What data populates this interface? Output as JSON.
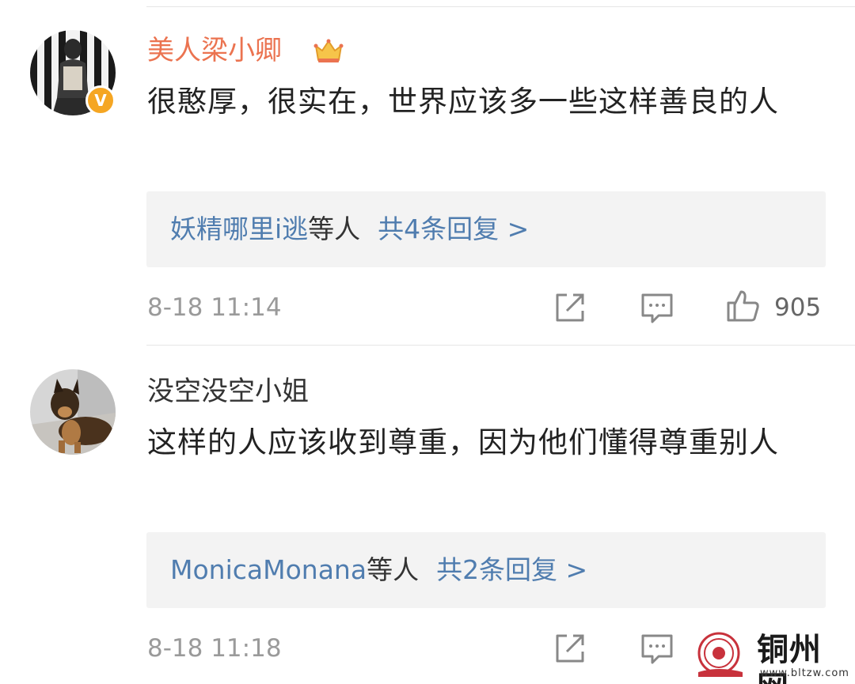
{
  "comments": [
    {
      "username": "美人梁小卿",
      "text": "很憨厚，很实在，世界应该多一些这样善良的人",
      "replies": {
        "names": "妖精哪里i逃",
        "suffix": "等人",
        "count": "共4条回复 >"
      },
      "time": "8-18 11:14",
      "likes": "905",
      "verified": "V",
      "badge_icon": "crown-icon"
    },
    {
      "username": "没空没空小姐",
      "text": "这样的人应该收到尊重，因为他们懂得尊重别人",
      "replies": {
        "names": "MonicaMonana",
        "suffix": "等人",
        "count": "共2条回复 >"
      },
      "time": "8-18 11:18",
      "likes": ""
    }
  ],
  "icons": {
    "share": "share-icon",
    "comment": "comment-icon",
    "like": "thumbs-up-icon"
  },
  "watermark": {
    "text": "铜州网",
    "url": "www.bltzw.com"
  },
  "colors": {
    "vip_name": "#eb7350",
    "link": "#507daf",
    "meta": "#9a9a9a",
    "reply_bg": "#f3f3f3",
    "verified": "#f5a623"
  }
}
